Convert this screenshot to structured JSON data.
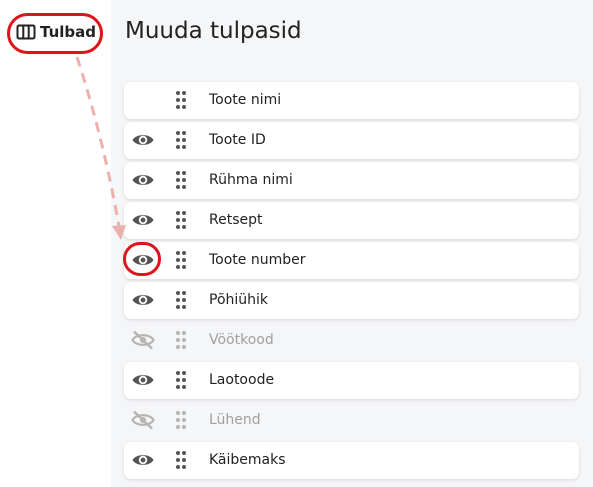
{
  "toolbar": {
    "columns_button_label": "Tulbad"
  },
  "panel": {
    "title": "Muuda tulpasid"
  },
  "rows": [
    {
      "label": "Toote nimi",
      "visible": true,
      "eye": "none"
    },
    {
      "label": "Toote ID",
      "visible": true,
      "eye": "eye-icon"
    },
    {
      "label": "Rühma nimi",
      "visible": true,
      "eye": "eye-icon"
    },
    {
      "label": "Retsept",
      "visible": true,
      "eye": "eye-icon"
    },
    {
      "label": "Toote number",
      "visible": true,
      "eye": "eye-icon"
    },
    {
      "label": "Põhiühik",
      "visible": true,
      "eye": "eye-icon"
    },
    {
      "label": "Vöötkood",
      "visible": false,
      "eye": "eye-off-icon"
    },
    {
      "label": "Laotoode",
      "visible": true,
      "eye": "eye-icon"
    },
    {
      "label": "Lühend",
      "visible": false,
      "eye": "eye-off-icon"
    },
    {
      "label": "Käibemaks",
      "visible": true,
      "eye": "eye-icon"
    }
  ],
  "colors": {
    "highlight": "#e0121b",
    "panel_bg": "#f5f6f8",
    "icon_active": "#555555",
    "icon_inactive": "#b5b5b5",
    "arrow": "#eab1ad"
  }
}
